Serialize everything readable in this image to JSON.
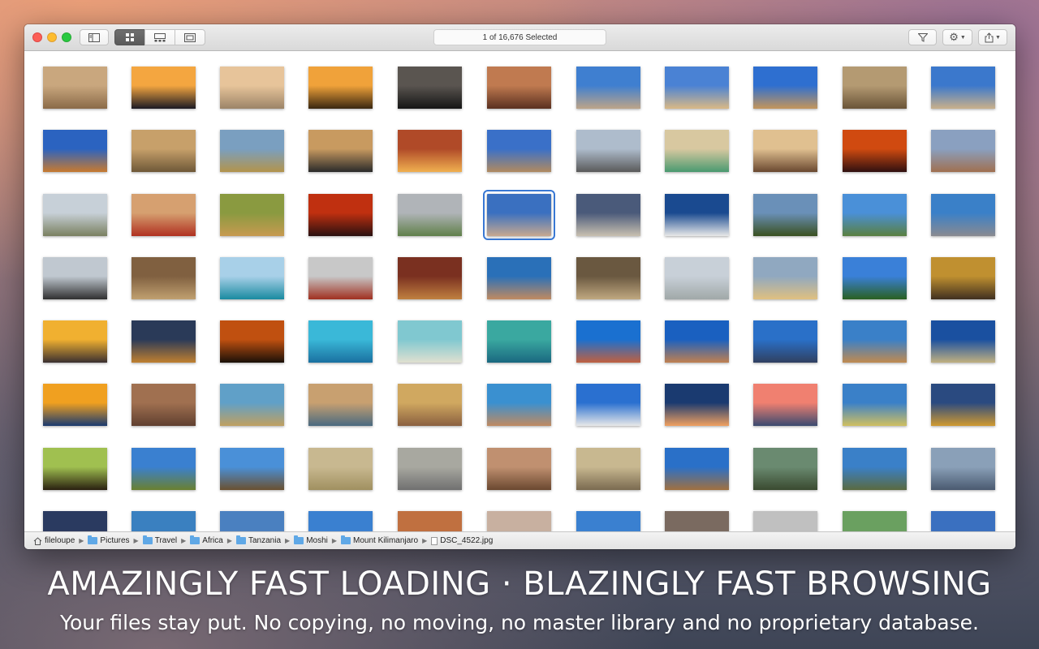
{
  "toolbar": {
    "status": "1 of 16,676 Selected",
    "icons": [
      "sidebar-icon",
      "grid-view-icon",
      "filmstrip-view-icon",
      "fullscreen-view-icon",
      "filter-icon",
      "gear-icon",
      "share-icon"
    ]
  },
  "pathbar": {
    "crumbs": [
      {
        "label": "fileloupe",
        "icon": "home-icon"
      },
      {
        "label": "Pictures",
        "icon": "folder-icon"
      },
      {
        "label": "Travel",
        "icon": "folder-icon"
      },
      {
        "label": "Africa",
        "icon": "folder-icon"
      },
      {
        "label": "Tanzania",
        "icon": "folder-icon"
      },
      {
        "label": "Moshi",
        "icon": "folder-icon"
      },
      {
        "label": "Mount Kilimanjaro",
        "icon": "folder-icon"
      },
      {
        "label": "DSC_4522.jpg",
        "icon": "file-icon"
      }
    ]
  },
  "marketing": {
    "headline": "AMAZINGLY FAST LOADING · BLAZINGLY FAST BROWSING",
    "subline": "Your files stay put. No copying, no moving, no master library and no proprietary database."
  },
  "thumbnails": {
    "selected_index": 27,
    "rows": [
      [
        [
          "#c9a77e",
          "#8a6a48"
        ],
        [
          "#f4a640",
          "#1b1a24"
        ],
        [
          "#e7c49a",
          "#9c8468"
        ],
        [
          "#f0a23a",
          "#3a2710"
        ],
        [
          "#5a5550",
          "#151515"
        ],
        [
          "#c07a50",
          "#5a3020"
        ],
        [
          "#3f7fd0",
          "#bda488"
        ],
        [
          "#4a82d4",
          "#d9b985"
        ],
        [
          "#2e6fd0",
          "#c4955a"
        ],
        [
          "#b49a72",
          "#6a5438"
        ],
        [
          "#3b78cc",
          "#c9b08a"
        ]
      ],
      [
        [
          "#2b63c0",
          "#c77a30"
        ],
        [
          "#c7a06a",
          "#6e5838"
        ],
        [
          "#7a9fc0",
          "#b3944c"
        ],
        [
          "#c89a60",
          "#2a2a2a"
        ],
        [
          "#b04a28",
          "#f0b050"
        ],
        [
          "#3a70c8",
          "#b08a60"
        ],
        [
          "#aebccc",
          "#5a5a5a"
        ],
        [
          "#d8c8a0",
          "#4a9a70"
        ],
        [
          "#e0c090",
          "#6a4830"
        ],
        [
          "#d04a10",
          "#301010"
        ],
        [
          "#8aa0c0",
          "#a07050"
        ]
      ],
      [
        [
          "#c7d0d8",
          "#7a8060"
        ],
        [
          "#d6a070",
          "#b03020"
        ],
        [
          "#8a9a40",
          "#c79a50"
        ],
        [
          "#c03010",
          "#2a1010"
        ],
        [
          "#b0b4b8",
          "#60804a"
        ],
        [
          "#3a70c0",
          "#c6a890"
        ],
        [
          "#4a5a7a",
          "#c8c0b0"
        ],
        [
          "#1a4a90",
          "#e8e8e8"
        ],
        [
          "#6a90b8",
          "#3a5020"
        ],
        [
          "#4a90d8",
          "#5a8040"
        ],
        [
          "#3a80c8",
          "#8a8a90"
        ]
      ],
      [
        [
          "#c0c8d0",
          "#303030"
        ],
        [
          "#806040",
          "#c0a070"
        ],
        [
          "#a8d0e8",
          "#1a8aa0"
        ],
        [
          "#c8c8c8",
          "#a03020"
        ],
        [
          "#7a3020",
          "#c08040"
        ],
        [
          "#2a70b8",
          "#c08a60"
        ],
        [
          "#6a5840",
          "#c0a880"
        ],
        [
          "#c8d0d8",
          "#a0a8a8"
        ],
        [
          "#90a8c0",
          "#e0c080"
        ],
        [
          "#3a80d8",
          "#2a6020"
        ],
        [
          "#c09030",
          "#403020"
        ]
      ],
      [
        [
          "#f0b030",
          "#3a3030"
        ],
        [
          "#2a3a58",
          "#c08030"
        ],
        [
          "#c05010",
          "#1a1008"
        ],
        [
          "#3ab8d8",
          "#1a70a0"
        ],
        [
          "#80c8d0",
          "#e0e0d0"
        ],
        [
          "#3aa8a0",
          "#1a6880"
        ],
        [
          "#1a70d0",
          "#c06040"
        ],
        [
          "#1a60c0",
          "#c08050"
        ],
        [
          "#2a70c8",
          "#304060"
        ],
        [
          "#3a80c8",
          "#c08a50"
        ],
        [
          "#1a50a0",
          "#c0b080"
        ]
      ],
      [
        [
          "#f0a020",
          "#1a3a70"
        ],
        [
          "#a07050",
          "#604030"
        ],
        [
          "#60a0c8",
          "#c0a060"
        ],
        [
          "#c8a070",
          "#4a6a80"
        ],
        [
          "#d0a860",
          "#8a6040"
        ],
        [
          "#3a90d0",
          "#c08a60"
        ],
        [
          "#2a70d0",
          "#e8e8e8"
        ],
        [
          "#1a3a70",
          "#f0a060"
        ],
        [
          "#f08070",
          "#3a4a70"
        ],
        [
          "#3a80c8",
          "#d0c060"
        ],
        [
          "#2a4a80",
          "#d09a30"
        ]
      ],
      [
        [
          "#a0c050",
          "#2a2010"
        ],
        [
          "#3a80d0",
          "#6a8030"
        ],
        [
          "#4a90d8",
          "#6a5030"
        ],
        [
          "#c8b890",
          "#a09060"
        ],
        [
          "#a8a8a0",
          "#707070"
        ],
        [
          "#c09070",
          "#6a4830"
        ],
        [
          "#c8b890",
          "#7a6a50"
        ],
        [
          "#2a70c8",
          "#a07040"
        ],
        [
          "#6a8a70",
          "#3a4a30"
        ],
        [
          "#3a80c8",
          "#5a6a40"
        ],
        [
          "#8aa0b8",
          "#4a5a70"
        ]
      ],
      [
        [
          "#2a3a60",
          "#c09060"
        ],
        [
          "#3a80c0",
          "#6a7060"
        ],
        [
          "#4a80c0",
          "#d09a60"
        ],
        [
          "#3a80d0",
          "#c8d0d8"
        ],
        [
          "#c07040",
          "#8a4020"
        ],
        [
          "#c8b0a0",
          "#6a7090"
        ],
        [
          "#3a80d0",
          "#a8b0b8"
        ],
        [
          "#7a6a60",
          "#c0b0a0"
        ],
        [
          "#c0c0c0",
          "#6a6a6a"
        ],
        [
          "#6aa060",
          "#c0a070"
        ],
        [
          "#3a70c0",
          "#c0a060"
        ]
      ]
    ]
  }
}
